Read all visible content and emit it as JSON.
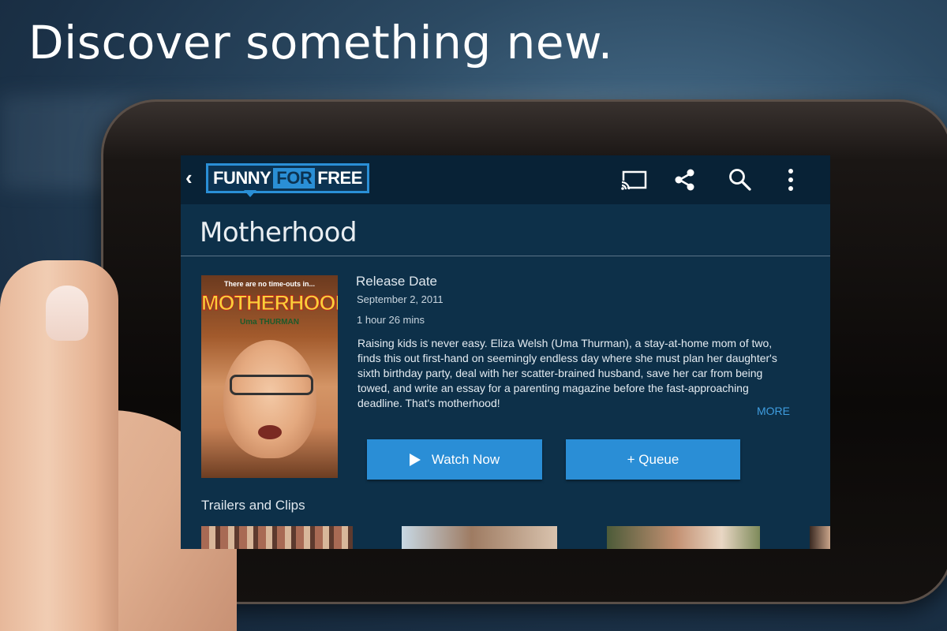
{
  "headline": "Discover something new.",
  "app_bar": {
    "back_icon": "chevron-left-icon",
    "logo": {
      "left": "FUNNY",
      "mid": "FOR",
      "right": "FREE"
    },
    "actions": [
      "cast-icon",
      "share-icon",
      "search-icon",
      "overflow-menu-icon"
    ]
  },
  "movie": {
    "title": "Motherhood",
    "poster": {
      "tagline": "There are no time-outs in...",
      "title": "MOTHERHOOD",
      "star": "Uma THURMAN"
    },
    "release_label": "Release Date",
    "release_date": "September 2, 2011",
    "runtime": "1 hour 26 mins",
    "description": "Raising kids is never easy. Eliza Welsh (Uma Thurman), a stay-at-home mom of two, finds this out first-hand on seemingly endless day where she must plan her daughter's sixth birthday party, deal with her scatter-brained husband, save her car from being towed, and write an essay for a parenting magazine before the fast-approaching deadline. That's motherhood!",
    "more_label": "MORE"
  },
  "buttons": {
    "watch_now": "Watch Now",
    "queue": "+ Queue"
  },
  "section_title": "Trailers and Clips",
  "colors": {
    "accent": "#2a8ed6",
    "app_bar": "#082236",
    "screen_bg": "#0d3049"
  }
}
